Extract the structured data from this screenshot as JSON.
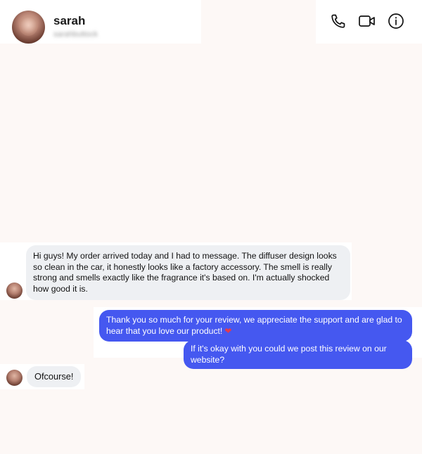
{
  "contact": {
    "name": "sarah",
    "handle": "sarahbuttock"
  },
  "header_icons": [
    "phone-icon",
    "video-camera-icon",
    "info-icon"
  ],
  "colors": {
    "background": "#fdf8f6",
    "incoming_bubble": "#eef0f3",
    "outgoing_bubble": "#4558f0",
    "heart": "#e33b4e"
  },
  "messages": [
    {
      "direction": "incoming",
      "text": "Hi guys! My order arrived today and I had to message. The diffuser design looks so clean in the car, it honestly looks like a factory accessory. The smell is really strong and smells exactly like the fragrance it's based on. I'm actually shocked how good it is."
    },
    {
      "direction": "outgoing",
      "text": "Thank you so much for your review, we appreciate the support and are glad to hear that you love our product!",
      "emoji": "❤"
    },
    {
      "direction": "outgoing",
      "text": "If it's okay with you could we post this review on our website?"
    },
    {
      "direction": "incoming",
      "text": "Ofcourse!"
    }
  ]
}
